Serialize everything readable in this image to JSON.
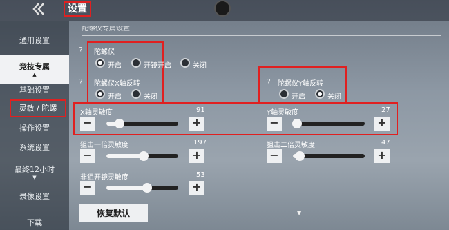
{
  "header": {
    "title": "设置",
    "back_icon": "back-chevron-icon"
  },
  "sidebar": {
    "items": [
      {
        "label": "通用设置"
      },
      {
        "label": "竞技专属",
        "active": true
      },
      {
        "label": "基础设置"
      },
      {
        "label": "灵敏 / 陀螺",
        "highlighted": true
      },
      {
        "label": "操作设置"
      },
      {
        "label": "系统设置"
      },
      {
        "label": "最终12小时"
      },
      {
        "label": "录像设置"
      },
      {
        "label": "下载"
      }
    ]
  },
  "content": {
    "section_title": "陀螺仪专属设置",
    "gyro": {
      "label": "陀螺仪",
      "options": [
        "开启",
        "开镜开启",
        "关闭"
      ],
      "selected": "开启"
    },
    "gyro_x_invert": {
      "label": "陀螺仪X轴反转",
      "options": [
        "开启",
        "关闭"
      ],
      "selected": "开启"
    },
    "gyro_y_invert": {
      "label": "陀螺仪Y轴反转",
      "options": [
        "开启",
        "关闭"
      ],
      "selected": "关闭"
    },
    "sliders": {
      "x_sens": {
        "label": "X轴灵敏度",
        "value": "91",
        "fraction": 0.18
      },
      "y_sens": {
        "label": "Y轴灵敏度",
        "value": "27",
        "fraction": 0.06
      },
      "sniper1": {
        "label": "狙击一倍灵敏度",
        "value": "197",
        "fraction": 0.52
      },
      "sniper2": {
        "label": "狙击二倍灵敏度",
        "value": "47",
        "fraction": 0.1
      },
      "non_sniper": {
        "label": "非狙开镜灵敏度",
        "value": "53",
        "fraction": 0.57
      }
    },
    "reset_label": "恢复默认",
    "minus": "−",
    "plus": "+"
  },
  "colors": {
    "highlight": "#e02020",
    "track": "#222222",
    "fill": "#f3f4f5"
  }
}
